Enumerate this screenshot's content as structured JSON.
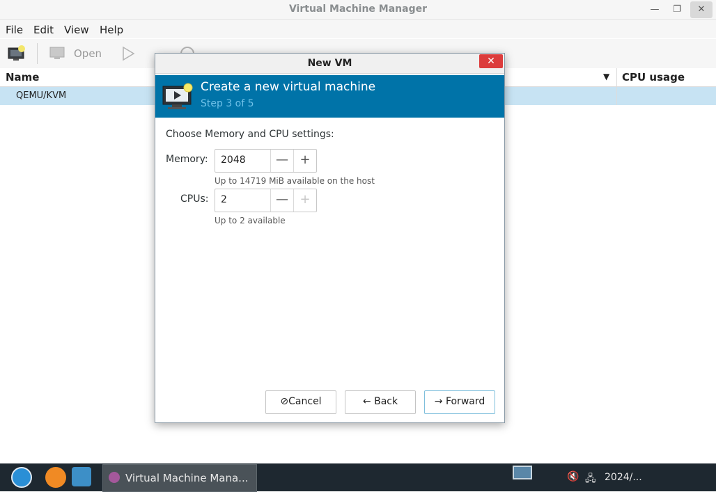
{
  "window": {
    "title": "Virtual Machine Manager"
  },
  "menu": [
    "File",
    "Edit",
    "View",
    "Help"
  ],
  "toolbar": {
    "open_label": "Open"
  },
  "list": {
    "columns": [
      "Name",
      "CPU usage"
    ],
    "rows": [
      "QEMU/KVM"
    ]
  },
  "dialog": {
    "title": "New VM",
    "close_glyph": "✕",
    "header": "Create a new virtual machine",
    "step": "Step 3 of 5",
    "intro": "Choose Memory and CPU settings:",
    "memory": {
      "label": "Memory:",
      "value": "2048",
      "hint": "Up to 14719 MiB available on the host"
    },
    "cpus": {
      "label": "CPUs:",
      "value": "2",
      "hint": "Up to 2 available"
    },
    "buttons": {
      "cancel": "Cancel",
      "back": "Back",
      "forward": "Forward"
    },
    "glyphs": {
      "minus": "—",
      "plus": "+",
      "cancel": "⊘",
      "back": "←",
      "forward": "→"
    }
  },
  "taskbar": {
    "task_label": "Virtual Machine Mana...",
    "clock": "2024/..."
  },
  "colors": {
    "accent": "#0073a8",
    "selection": "#c7e3f3",
    "close": "#dc3c3c"
  }
}
